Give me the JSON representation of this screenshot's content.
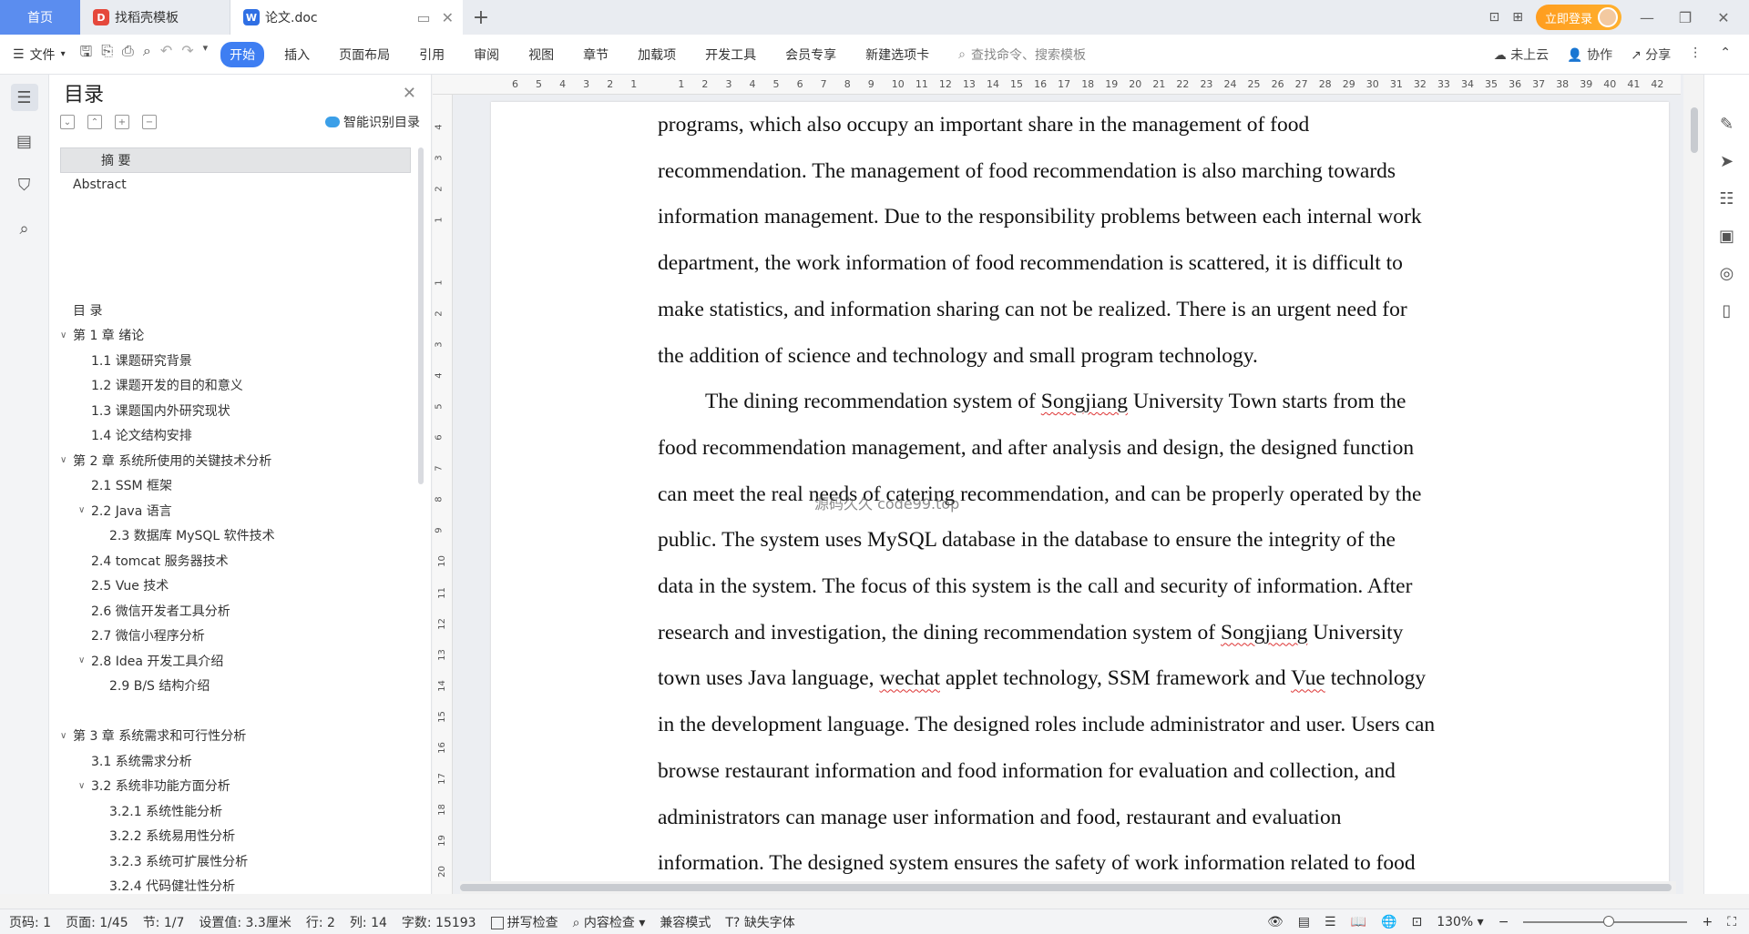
{
  "tabs": {
    "home": "首页",
    "template": "找稻壳模板",
    "doc": "论文.doc"
  },
  "titlebar": {
    "login": "立即登录"
  },
  "ribbon": {
    "file": "文件",
    "tabs": [
      "开始",
      "插入",
      "页面布局",
      "引用",
      "审阅",
      "视图",
      "章节",
      "加载项",
      "开发工具",
      "会员专享",
      "新建选项卡"
    ],
    "search_placeholder": "查找命令、搜索模板",
    "cloud": "未上云",
    "collab": "协作",
    "share": "分享"
  },
  "toc": {
    "title": "目录",
    "smart": "智能识别目录",
    "items": [
      {
        "text": "摘  要",
        "level": 1,
        "sel": true
      },
      {
        "text": "Abstract",
        "level": 0
      },
      {
        "text": "",
        "level": 0
      },
      {
        "text": "",
        "level": 0
      },
      {
        "text": "",
        "level": 0
      },
      {
        "text": "",
        "level": 0
      },
      {
        "text": "目  录",
        "level": 0
      },
      {
        "text": "第 1 章  绪论",
        "level": 0,
        "tw": "v"
      },
      {
        "text": "1.1    课题研究背景",
        "level": 1
      },
      {
        "text": "1.2  课题开发的目的和意义",
        "level": 1
      },
      {
        "text": "1.3    课题国内外研究现状",
        "level": 1
      },
      {
        "text": "1.4  论文结构安排",
        "level": 1
      },
      {
        "text": "第 2 章  系统所使用的关键技术分析",
        "level": 0,
        "tw": "v"
      },
      {
        "text": "2.1 SSM 框架",
        "level": 1
      },
      {
        "text": "2.2 Java 语言",
        "level": 1,
        "tw": "v"
      },
      {
        "text": "2.3  数据库 MySQL 软件技术",
        "level": 2
      },
      {
        "text": "2.4 tomcat 服务器技术",
        "level": 1
      },
      {
        "text": "2.5 Vue 技术",
        "level": 1
      },
      {
        "text": "2.6  微信开发者工具分析",
        "level": 1
      },
      {
        "text": "2.7 微信小程序分析",
        "level": 1
      },
      {
        "text": "2.8 Idea 开发工具介绍",
        "level": 1,
        "tw": "v"
      },
      {
        "text": "2.9 B/S 结构介绍",
        "level": 2
      },
      {
        "text": "",
        "level": 0
      },
      {
        "text": "第 3 章  系统需求和可行性分析",
        "level": 0,
        "tw": "v"
      },
      {
        "text": "3.1 系统需求分析",
        "level": 1
      },
      {
        "text": "3.2 系统非功能方面分析",
        "level": 1,
        "tw": "v"
      },
      {
        "text": "3.2.1 系统性能分析",
        "level": 2
      },
      {
        "text": "3.2.2 系统易用性分析",
        "level": 2
      },
      {
        "text": "3.2.3 系统可扩展性分析",
        "level": 2
      },
      {
        "text": "3.2.4 代码健壮性分析",
        "level": 2
      }
    ]
  },
  "ruler": {
    "h": [
      "6",
      "5",
      "4",
      "3",
      "2",
      "1",
      "",
      "1",
      "2",
      "3",
      "4",
      "5",
      "6",
      "7",
      "8",
      "9",
      "10",
      "11",
      "12",
      "13",
      "14",
      "15",
      "16",
      "17",
      "18",
      "19",
      "20",
      "21",
      "22",
      "23",
      "24",
      "25",
      "26",
      "27",
      "28",
      "29",
      "30",
      "31",
      "32",
      "33",
      "34",
      "35",
      "36",
      "37",
      "38",
      "39",
      "40",
      "41",
      "42"
    ],
    "v": [
      "4",
      "3",
      "2",
      "1",
      "",
      "1",
      "2",
      "3",
      "4",
      "5",
      "6",
      "7",
      "8",
      "9",
      "10",
      "11",
      "12",
      "13",
      "14",
      "15",
      "16",
      "17",
      "18",
      "19",
      "20"
    ]
  },
  "document": {
    "lines": [
      "programs, which also occupy an important share in the management of food",
      "recommendation. The management of food recommendation is also marching towards",
      "information management. Due to the responsibility problems between each internal work",
      "department, the work information of food recommendation is scattered, it is difficult to",
      "make statistics, and information sharing can not be realized. There is an urgent need for",
      "the addition of science and technology and small program technology."
    ],
    "p2": [
      "The dining recommendation system of Songjiang University Town starts from the",
      "food recommendation management, and after analysis and design, the designed function",
      "can meet the real needs of catering recommendation, and can be properly operated by the",
      "public. The system uses MySQL database in the database to ensure the integrity of the",
      "data in the system. The focus of this system is the call and security of information. After",
      "research and investigation, the dining recommendation system of Songjiang University",
      "town uses Java language, wechat applet technology, SSM framework and Vue technology",
      "in the development language. The designed roles include administrator and user. Users can",
      "browse restaurant information and food information for evaluation and collection, and",
      "administrators can manage user information and food, restaurant and evaluation",
      "information. The designed system ensures the safety of work information related to food"
    ],
    "watermark": "源码久久 code99.top"
  },
  "status": {
    "page": "页码: 1",
    "pages": "页面: 1/45",
    "section": "节: 1/7",
    "setting": "设置值: 3.3厘米",
    "row": "行: 2",
    "col": "列: 14",
    "words": "字数: 15193",
    "spell": "拼写检查",
    "content": "内容检查",
    "compat": "兼容模式",
    "missing_font": "缺失字体",
    "zoom": "130%"
  }
}
